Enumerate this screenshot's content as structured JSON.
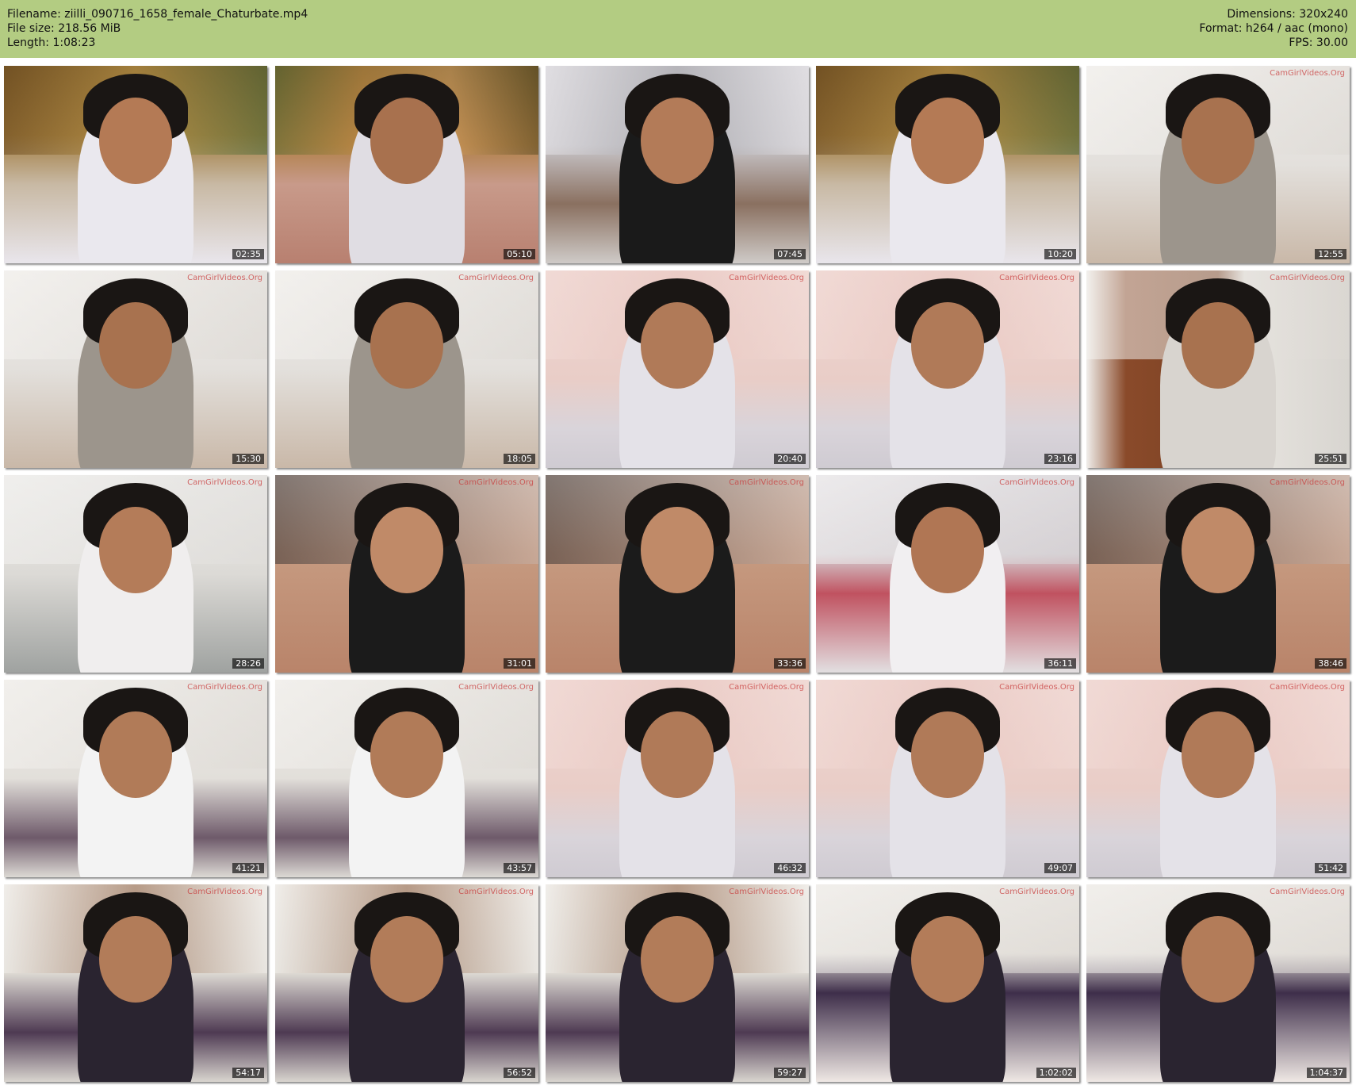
{
  "header": {
    "filename": "Filename: ziilli_090716_1658_female_Chaturbate.mp4",
    "filesize": "File size: 218.56 MiB",
    "length": "Length: 1:08:23",
    "dimensions": "Dimensions: 320x240",
    "format": "Format: h264 / aac (mono)",
    "fps": "FPS: 30.00"
  },
  "watermark": "CamGirlVideos.Org",
  "thumbnails": [
    {
      "time": "02:35",
      "scene": "tapestry-closeup"
    },
    {
      "time": "05:10",
      "scene": "tapestry-far"
    },
    {
      "time": "07:45",
      "scene": "standing-closeup"
    },
    {
      "time": "10:20",
      "scene": "tapestry-closeup"
    },
    {
      "time": "12:55",
      "scene": "room"
    },
    {
      "time": "15:30",
      "scene": "room"
    },
    {
      "time": "18:05",
      "scene": "room"
    },
    {
      "time": "20:40",
      "scene": "pillow-face"
    },
    {
      "time": "23:16",
      "scene": "pillow-face"
    },
    {
      "time": "25:51",
      "scene": "room-wardrobe"
    },
    {
      "time": "28:26",
      "scene": "bed-closeup"
    },
    {
      "time": "31:01",
      "scene": "face-closeup"
    },
    {
      "time": "33:36",
      "scene": "face-closeup"
    },
    {
      "time": "36:11",
      "scene": "bed-laughing"
    },
    {
      "time": "38:46",
      "scene": "face-closeup"
    },
    {
      "time": "41:21",
      "scene": "room-sitting"
    },
    {
      "time": "43:57",
      "scene": "room-sitting"
    },
    {
      "time": "46:32",
      "scene": "pillow-face"
    },
    {
      "time": "49:07",
      "scene": "pillow-face"
    },
    {
      "time": "51:42",
      "scene": "pillow-face"
    },
    {
      "time": "54:17",
      "scene": "room-lying"
    },
    {
      "time": "56:52",
      "scene": "room-lying"
    },
    {
      "time": "59:27",
      "scene": "room-lying"
    },
    {
      "time": "1:02:02",
      "scene": "floral-pillow"
    },
    {
      "time": "1:04:37",
      "scene": "floral-pillow"
    }
  ]
}
